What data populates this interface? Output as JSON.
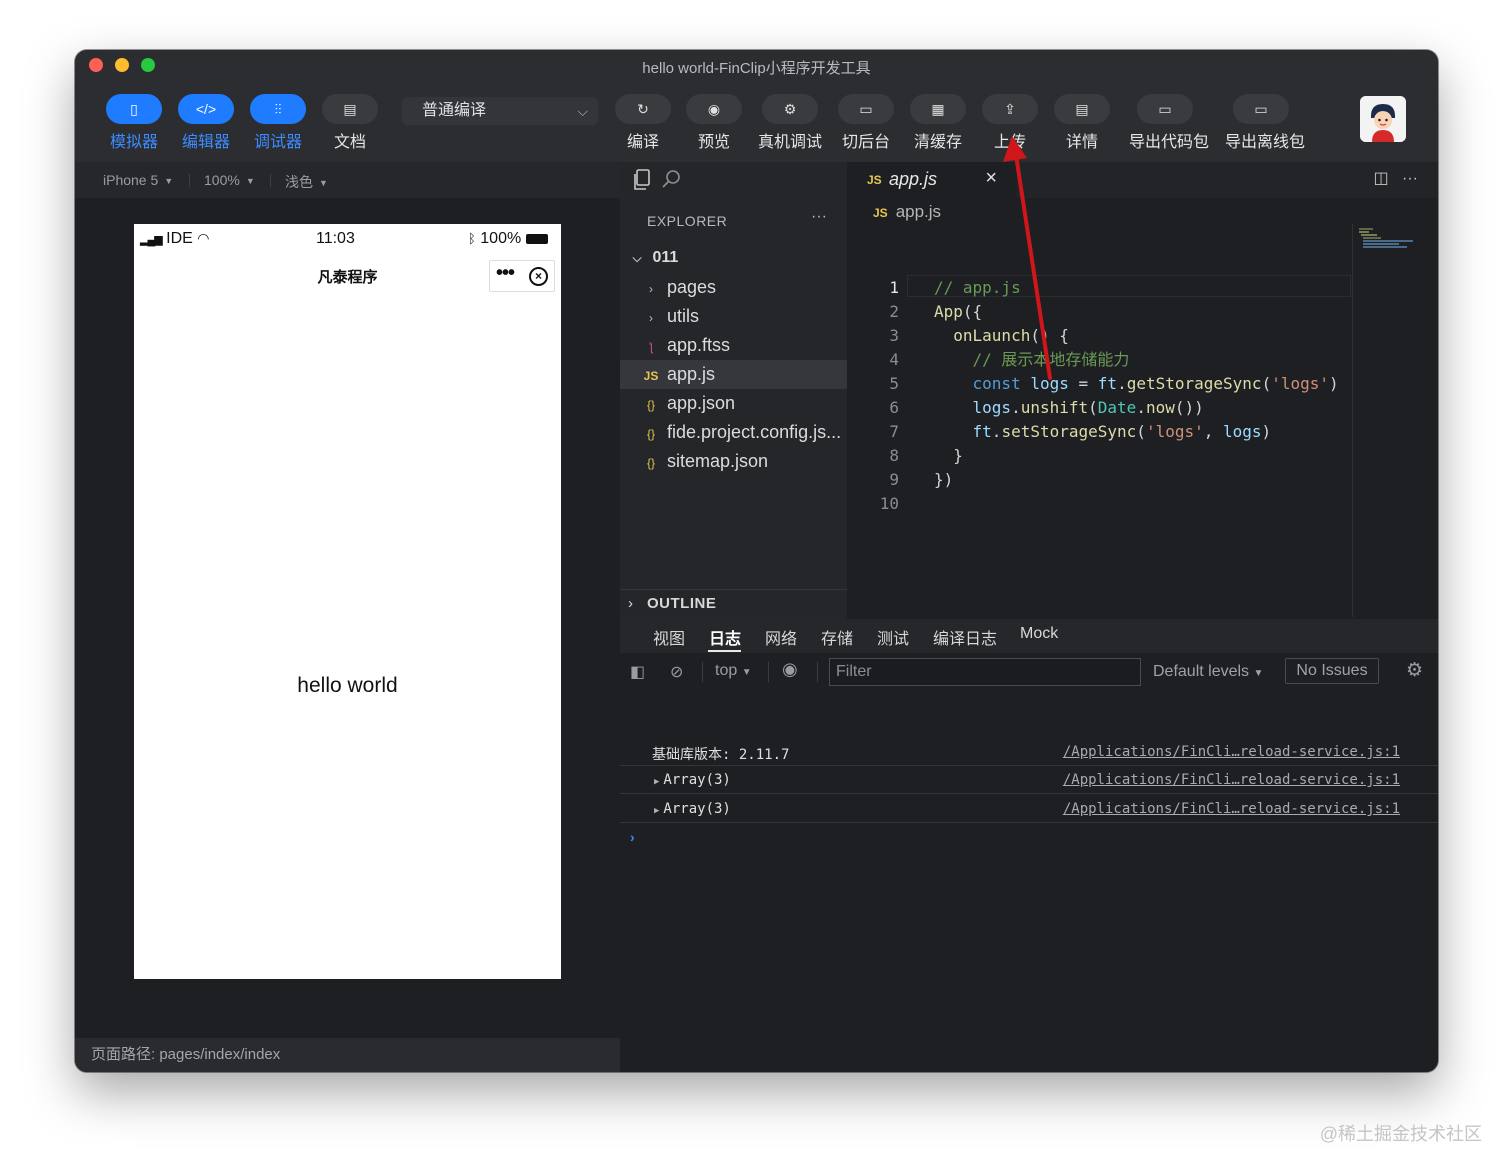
{
  "window": {
    "title": "hello world-FinClip小程序开发工具"
  },
  "toolbar": {
    "modes": [
      {
        "label": "模拟器",
        "icon": "phone-icon",
        "active": true
      },
      {
        "label": "编辑器",
        "icon": "code-icon",
        "active": true
      },
      {
        "label": "调试器",
        "icon": "sliders-icon",
        "active": true
      },
      {
        "label": "文档",
        "icon": "document-icon",
        "active": false
      }
    ],
    "compile_mode": "普通编译",
    "actions": [
      {
        "label": "编译",
        "icon": "refresh-icon"
      },
      {
        "label": "预览",
        "icon": "eye-icon"
      },
      {
        "label": "真机调试",
        "icon": "bug-icon"
      },
      {
        "label": "切后台",
        "icon": "background-icon"
      },
      {
        "label": "清缓存",
        "icon": "clear-cache-icon"
      },
      {
        "label": "上传",
        "icon": "upload-icon"
      },
      {
        "label": "详情",
        "icon": "details-icon"
      },
      {
        "label": "导出代码包",
        "icon": "folder-icon"
      },
      {
        "label": "导出离线包",
        "icon": "folder-icon"
      }
    ]
  },
  "simulator": {
    "device": "iPhone 5",
    "zoom": "100%",
    "theme": "浅色",
    "status": {
      "carrier": "IDE",
      "time": "11:03",
      "battery": "100%"
    },
    "nav_title": "凡泰程序",
    "content": "hello world",
    "footer": "页面路径: pages/index/index"
  },
  "explorer": {
    "header": "EXPLORER",
    "project": "011",
    "items": [
      {
        "name": "pages",
        "type": "folder"
      },
      {
        "name": "utils",
        "type": "folder"
      },
      {
        "name": "app.ftss",
        "type": "css"
      },
      {
        "name": "app.js",
        "type": "js"
      },
      {
        "name": "app.json",
        "type": "json"
      },
      {
        "name": "fide.project.config.js...",
        "type": "json"
      },
      {
        "name": "sitemap.json",
        "type": "json"
      }
    ],
    "outline": "OUTLINE"
  },
  "editor": {
    "tab": "app.js",
    "breadcrumb": "app.js",
    "line_numbers": [
      "1",
      "2",
      "3",
      "4",
      "5",
      "6",
      "7",
      "8",
      "9",
      "10"
    ]
  },
  "devtools": {
    "tabs": [
      "视图",
      "日志",
      "网络",
      "存储",
      "测试",
      "编译日志",
      "Mock"
    ],
    "active_tab": "日志",
    "context": "top",
    "filter_placeholder": "Filter",
    "levels": "Default levels",
    "issues": "No Issues",
    "rows": [
      {
        "message": "基础库版本: 2.11.7",
        "expandable": false,
        "source": "/Applications/FinCli…reload-service.js:1"
      },
      {
        "message": "Array(3)",
        "expandable": true,
        "source": "/Applications/FinCli…reload-service.js:1"
      },
      {
        "message": "Array(3)",
        "expandable": true,
        "source": "/Applications/FinCli…reload-service.js:1"
      }
    ],
    "prompt": "›"
  },
  "watermark": "@稀土掘金技术社区",
  "colors": {
    "accent": "#1f7bff",
    "arrow": "#d0161a",
    "background": "#1e1f22"
  }
}
